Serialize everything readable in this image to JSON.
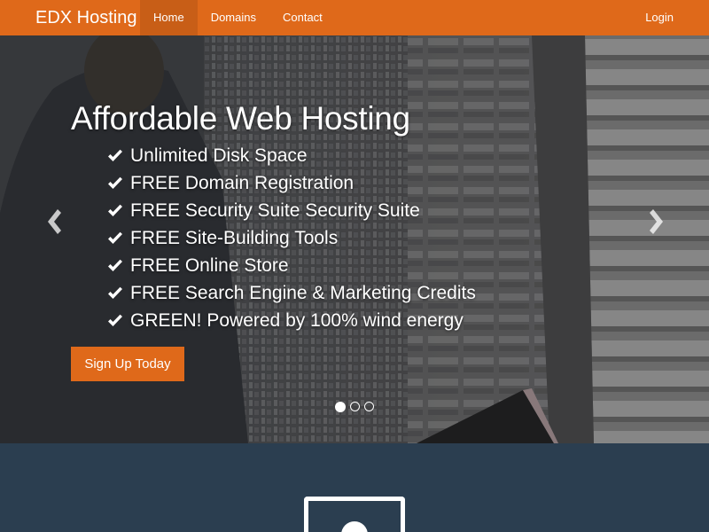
{
  "navbar": {
    "brand": "EDX Hosting",
    "items": [
      {
        "label": "Home",
        "active": true
      },
      {
        "label": "Domains",
        "active": false
      },
      {
        "label": "Contact",
        "active": false
      }
    ],
    "login": "Login"
  },
  "hero": {
    "title": "Affordable Web Hosting",
    "features": [
      "Unlimited Disk Space",
      "FREE Domain Registration",
      "FREE Security Suite Security Suite",
      "FREE Site-Building Tools",
      "FREE Online Store",
      "FREE Search Engine & Marketing Credits",
      "GREEN! Powered by 100% wind energy"
    ],
    "cta": "Sign Up Today",
    "slides": 3,
    "active_slide": 1,
    "background": "server-room-photo"
  },
  "section": {
    "icon": "monitor-icon"
  },
  "colors": {
    "accent": "#df691a",
    "accent_dark": "#c85e17",
    "section_bg": "#2b3e50",
    "text": "#ffffff"
  }
}
